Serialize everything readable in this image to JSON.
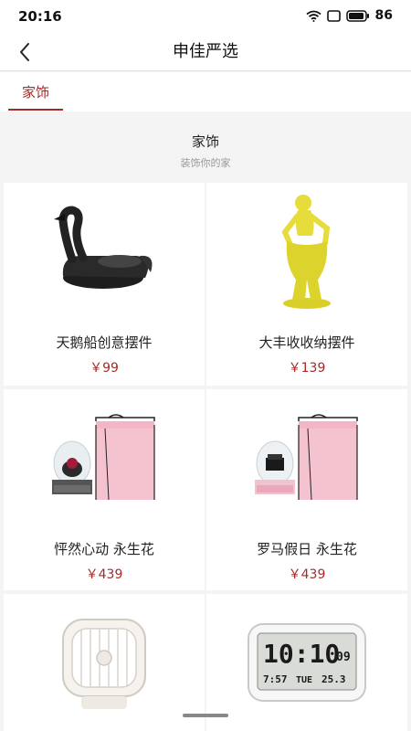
{
  "status": {
    "time": "20:16",
    "battery": "86"
  },
  "header": {
    "title": "申佳严选"
  },
  "tabs": [
    {
      "label": "家饰",
      "active": true
    }
  ],
  "section": {
    "title": "家饰",
    "subtitle": "装饰你的家"
  },
  "products": [
    {
      "name": "天鹅船创意摆件",
      "price": "￥99",
      "icon": "swan-figurine"
    },
    {
      "name": "大丰收收纳摆件",
      "price": "￥139",
      "icon": "yellow-figurine"
    },
    {
      "name": "怦然心动 永生花",
      "price": "￥439",
      "icon": "flower-dome-gift-box"
    },
    {
      "name": "罗马假日 永生花",
      "price": "￥439",
      "icon": "flower-dome-gift-box"
    },
    {
      "name": "",
      "price": "",
      "icon": "desk-fan"
    },
    {
      "name": "",
      "price": "",
      "icon": "digital-clock"
    }
  ],
  "clock_display": {
    "time": "10:10",
    "seconds": "09",
    "sub_time": "7:57",
    "day": "TUE",
    "date": "25.3"
  },
  "colors": {
    "accent": "#a52a2a",
    "background": "#f4f4f4"
  }
}
